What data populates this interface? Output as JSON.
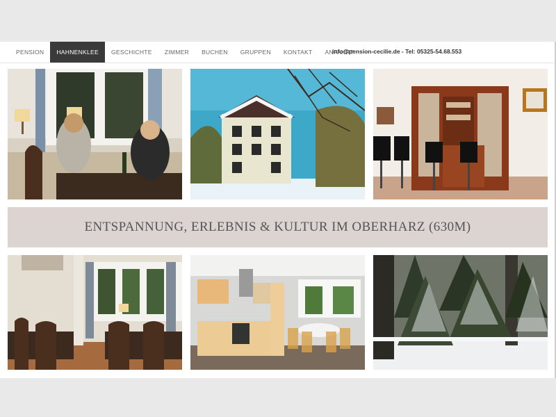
{
  "nav": {
    "items": [
      {
        "label": "PENSION",
        "active": false
      },
      {
        "label": "HAHNENKLEE",
        "active": true
      },
      {
        "label": "GESCHICHTE",
        "active": false
      },
      {
        "label": "ZIMMER",
        "active": false
      },
      {
        "label": "BUCHEN",
        "active": false
      },
      {
        "label": "GRUPPEN",
        "active": false
      },
      {
        "label": "KONTAKT",
        "active": false
      },
      {
        "label": "ANFAHRT",
        "active": false
      }
    ]
  },
  "contact": {
    "text": "info@pension-cecilie.de - Tel: 05325-54.68.553"
  },
  "banner": {
    "text": "ENTSPANNUNG, ERLEBNIS & KULTUR IM OBERHARZ (630M)"
  },
  "colors": {
    "nav_active_bg": "#3a3a3a",
    "banner_bg": "#dcd4d1",
    "page_bg": "#e9e9e9"
  }
}
